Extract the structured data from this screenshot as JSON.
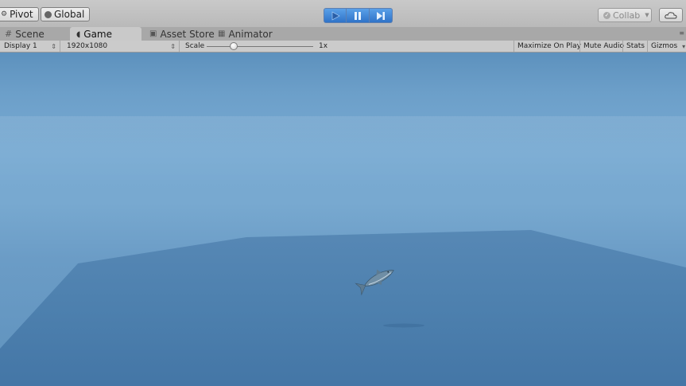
{
  "toolbar": {
    "pivot_label": "Pivot",
    "global_label": "Global",
    "collab_label": "Collab",
    "play_icons": [
      "play-icon",
      "pause-icon",
      "step-icon"
    ]
  },
  "tabs": [
    {
      "label": "Scene",
      "icon": "grid-icon",
      "active": false
    },
    {
      "label": "Game",
      "icon": "pacman-icon",
      "active": true
    },
    {
      "label": "Asset Store",
      "icon": "store-icon",
      "active": false
    },
    {
      "label": "Animator",
      "icon": "animator-icon",
      "active": false
    }
  ],
  "game_controls": {
    "display": "Display 1",
    "resolution": "1920x1080",
    "scale_label": "Scale",
    "scale_value": "1x",
    "maximize": "Maximize On Play",
    "mute": "Mute Audio",
    "stats": "Stats",
    "gizmos": "Gizmos"
  },
  "colors": {
    "play_accent": "#2f73c8",
    "sky": "#78aad2",
    "water_plane": "#4a7fae"
  }
}
